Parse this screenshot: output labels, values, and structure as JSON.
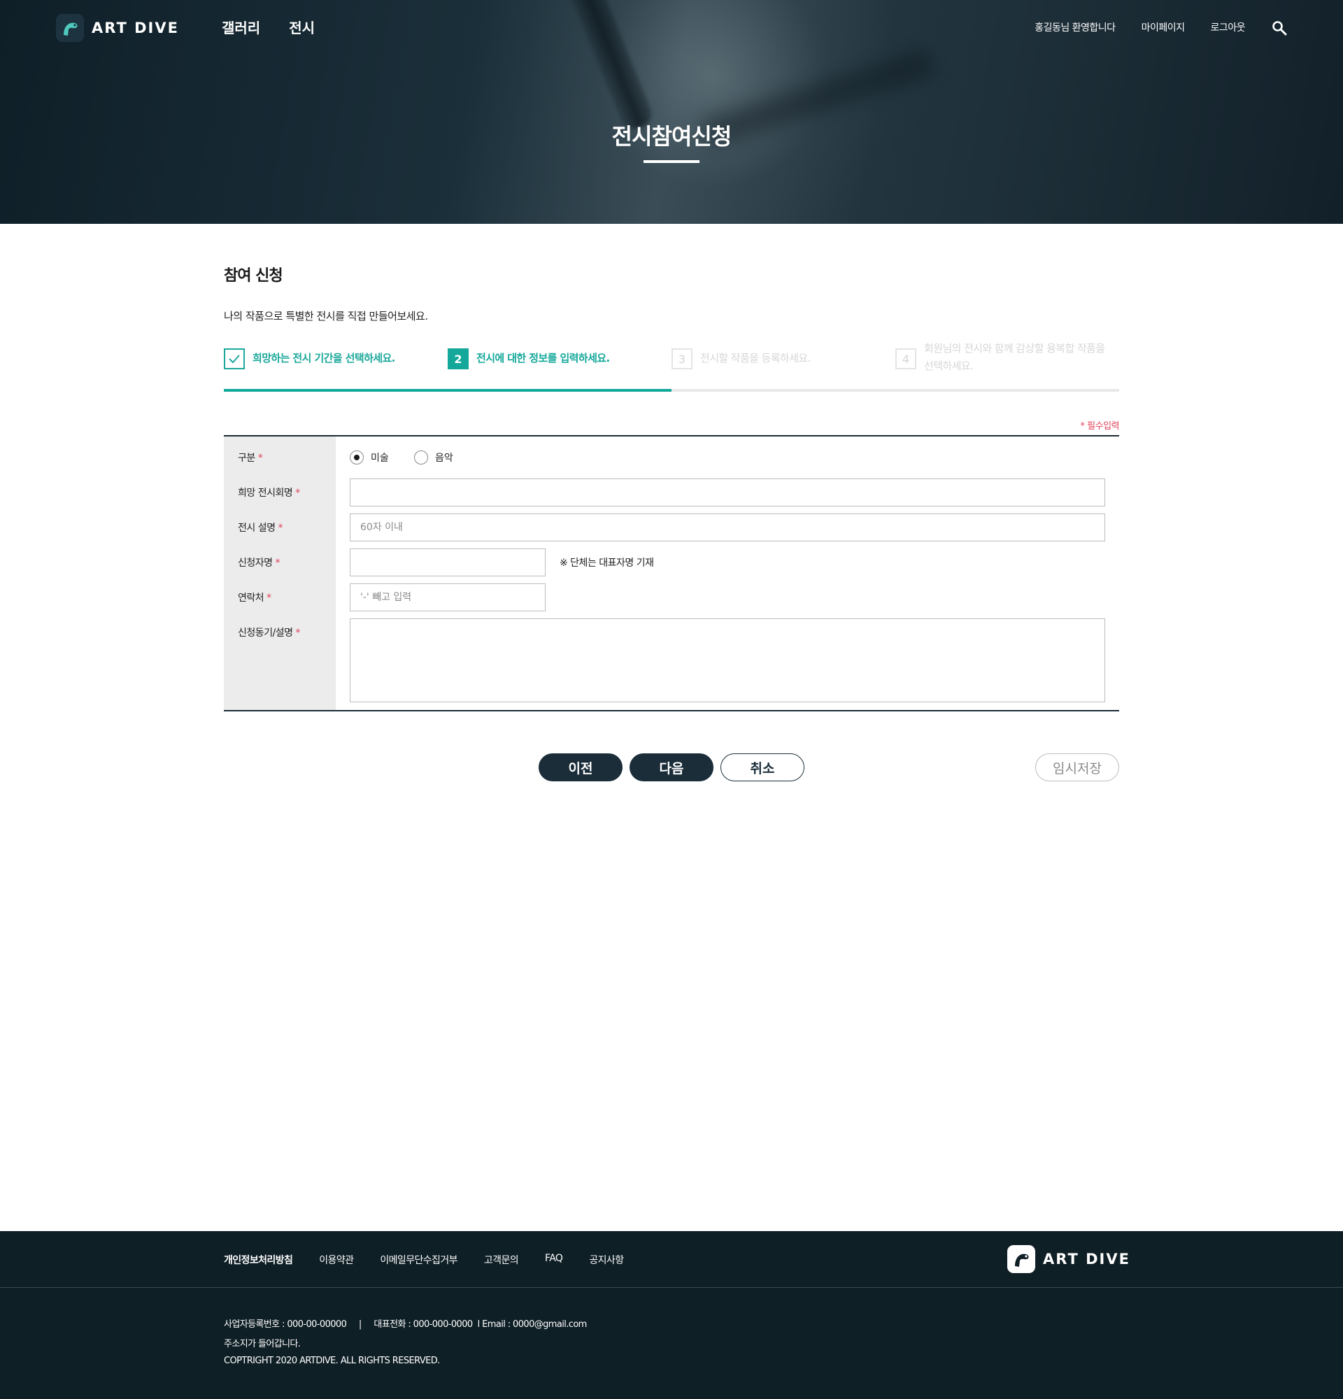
{
  "brand": {
    "name": "ART DIVE",
    "accent": "#14a89a",
    "dark": "#1a2d39",
    "required_color": "#e0425a"
  },
  "header": {
    "nav_main": [
      "갤러리",
      "전시"
    ],
    "welcome": "홍길동님 환영합니다",
    "mypage": "마이페이지",
    "logout": "로그아웃",
    "search_icon": "search-icon"
  },
  "hero": {
    "title": "전시참여신청"
  },
  "page": {
    "title": "참여 신청",
    "description": "나의 작품으로 특별한 전시를 직접 만들어보세요."
  },
  "steps": {
    "progress": 0.5,
    "items": [
      {
        "number": "",
        "icon": "check-icon",
        "label": "희망하는 전시 기간을 선택하세요.",
        "state": "done"
      },
      {
        "number": "2",
        "label": "전시에 대한 정보를 입력하세요.",
        "state": "active"
      },
      {
        "number": "3",
        "label": "전시할 작품을 등록하세요.",
        "state": "todo"
      },
      {
        "number": "4",
        "label": "회원님의 전시와 함께 감상할 융복합 작품을 선택하세요.",
        "state": "todo"
      }
    ]
  },
  "form": {
    "required_note": "* 필수입력",
    "required_mark": "*",
    "category": {
      "label": "구분",
      "options": [
        "미술",
        "음악"
      ],
      "selected": "미술"
    },
    "exhibition_name": {
      "label": "희망 전시회명",
      "value": "",
      "placeholder": ""
    },
    "exhibition_desc": {
      "label": "전시 설명",
      "value": "",
      "placeholder": "60자 이내"
    },
    "applicant": {
      "label": "신청자명",
      "value": "",
      "placeholder": "",
      "hint": "※ 단체는 대표자명 기재"
    },
    "contact": {
      "label": "연락처",
      "value": "",
      "placeholder": "'-' 빼고 입력"
    },
    "motivation": {
      "label": "신청동기/설명",
      "value": ""
    }
  },
  "buttons": {
    "prev": "이전",
    "next": "다음",
    "cancel": "취소",
    "save_draft": "임시저장"
  },
  "footer": {
    "links": [
      "개인정보처리방침",
      "이용약관",
      "이메일무단수집거부",
      "고객문의",
      "FAQ",
      "공지사항"
    ],
    "info_line1": "사업자등록번호 : 000-00-00000     |     대표전화 : 000-000-0000  l Email : 0000@gmail.com",
    "info_line2": "주소지가 들어갑니다.",
    "copyright": "COPTRIGHT 2020 ARTDIVE. ALL RIGHTS RESERVED."
  }
}
